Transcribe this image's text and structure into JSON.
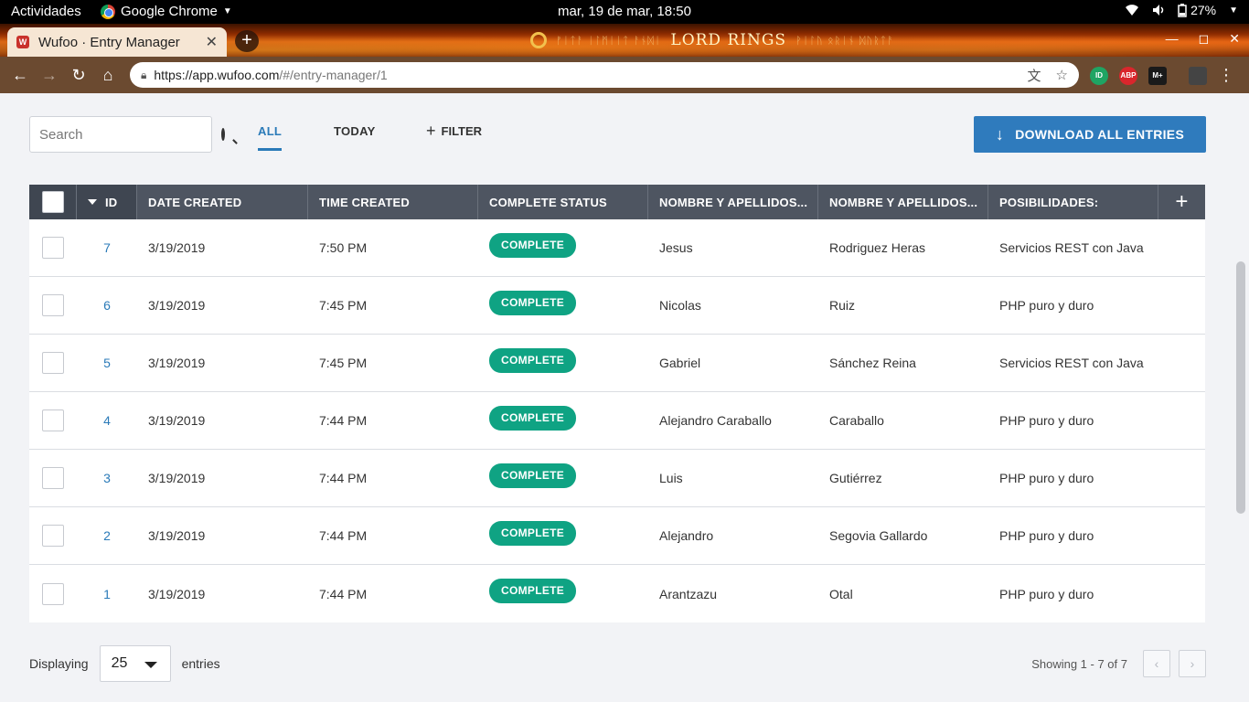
{
  "os": {
    "activities": "Actividades",
    "app_name": "Google Chrome",
    "clock": "mar, 19 de mar, 18:50",
    "battery": "27%"
  },
  "browser": {
    "tab_title": "Wufoo · Entry Manager",
    "favicon_letter": "W",
    "url_host": "https://app.wufoo.com",
    "url_path": "/#/entry-manager/1",
    "theme_logo": "LORD RINGS",
    "theme_logo_small": "OF THE",
    "extensions": [
      {
        "name": "ID",
        "color": "#1fa463"
      },
      {
        "name": "ABP",
        "color": "#d9262c"
      },
      {
        "name": "M+",
        "color": "#1a1a1a"
      }
    ]
  },
  "toolbar": {
    "search_placeholder": "Search",
    "tabs": [
      "ALL",
      "TODAY"
    ],
    "filter_label": "FILTER",
    "download_label": "DOWNLOAD ALL ENTRIES"
  },
  "table": {
    "headers": [
      "ID",
      "DATE CREATED",
      "TIME CREATED",
      "COMPLETE STATUS",
      "NOMBRE Y APELLIDOS...",
      "NOMBRE Y APELLIDOS...",
      "POSIBILIDADES:"
    ],
    "add_column": "+",
    "rows": [
      {
        "id": "7",
        "date": "3/19/2019",
        "time": "7:50 PM",
        "status": "COMPLETE",
        "nombre": "Jesus",
        "apellidos": "Rodriguez Heras",
        "posibilidades": "Servicios REST con Java"
      },
      {
        "id": "6",
        "date": "3/19/2019",
        "time": "7:45 PM",
        "status": "COMPLETE",
        "nombre": "Nicolas",
        "apellidos": "Ruiz",
        "posibilidades": "PHP puro y duro"
      },
      {
        "id": "5",
        "date": "3/19/2019",
        "time": "7:45 PM",
        "status": "COMPLETE",
        "nombre": "Gabriel",
        "apellidos": "Sánchez Reina",
        "posibilidades": "Servicios REST con Java"
      },
      {
        "id": "4",
        "date": "3/19/2019",
        "time": "7:44 PM",
        "status": "COMPLETE",
        "nombre": "Alejandro Caraballo",
        "apellidos": "Caraballo",
        "posibilidades": "PHP puro y duro"
      },
      {
        "id": "3",
        "date": "3/19/2019",
        "time": "7:44 PM",
        "status": "COMPLETE",
        "nombre": "Luis",
        "apellidos": "Gutiérrez",
        "posibilidades": "PHP puro y duro"
      },
      {
        "id": "2",
        "date": "3/19/2019",
        "time": "7:44 PM",
        "status": "COMPLETE",
        "nombre": "Alejandro",
        "apellidos": "Segovia Gallardo",
        "posibilidades": "PHP puro y duro"
      },
      {
        "id": "1",
        "date": "3/19/2019",
        "time": "7:44 PM",
        "status": "COMPLETE",
        "nombre": "Arantzazu",
        "apellidos": "Otal",
        "posibilidades": "PHP puro y duro"
      }
    ]
  },
  "footer": {
    "displaying_label": "Displaying",
    "per_page": "25",
    "entries_label": "entries",
    "showing": "Showing 1 - 7 of 7"
  }
}
